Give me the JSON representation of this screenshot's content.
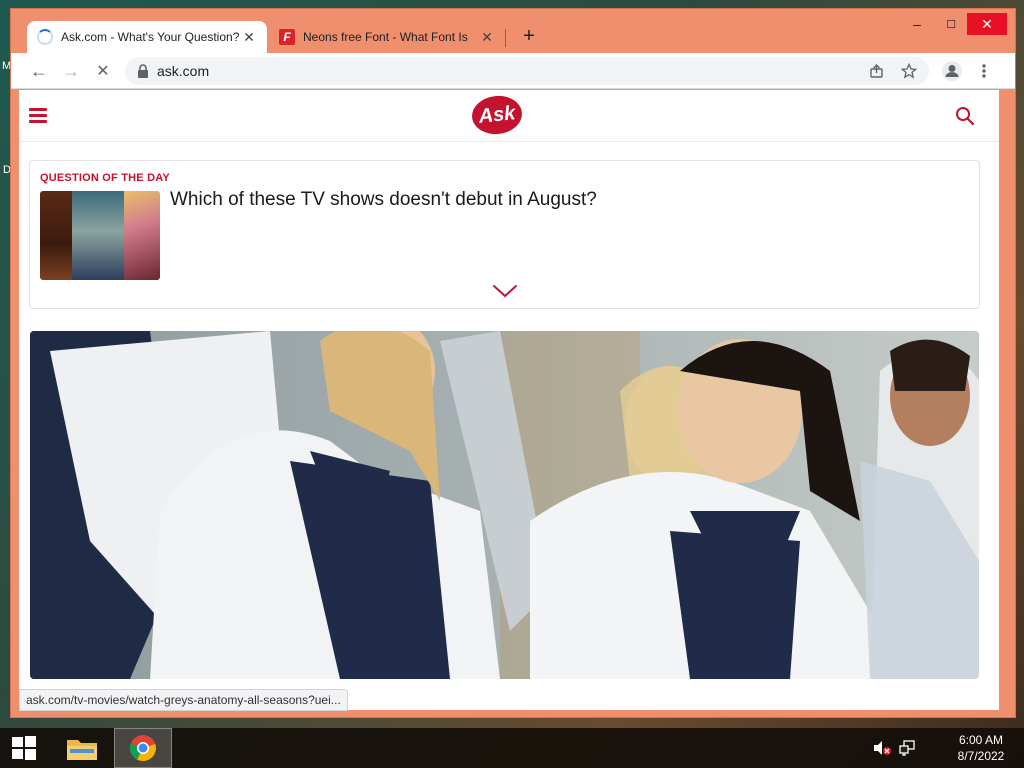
{
  "desktop": {
    "edge_text_1": "M",
    "edge_text_2": "D"
  },
  "browser": {
    "tabs": [
      {
        "title": "Ask.com - What's Your Question?",
        "close": "✕",
        "active": true
      },
      {
        "title": "Neons free Font - What Font Is",
        "close": "✕",
        "active": false,
        "favicon": "F"
      }
    ],
    "new_tab": "+",
    "window_controls": {
      "minimize": "–",
      "maximize": "☐",
      "close": "✕"
    },
    "nav": {
      "back": "←",
      "forward": "→",
      "stop": "✕"
    },
    "url": "ask.com",
    "status_url": "ask.com/tv-movies/watch-greys-anatomy-all-seasons?uei..."
  },
  "page": {
    "brand": "Ask",
    "question_of_day": {
      "label": "QUESTION OF THE DAY",
      "question": "Which of these TV shows doesn't debut in August?"
    }
  },
  "taskbar": {
    "time": "6:00 AM",
    "date": "8/7/2022"
  },
  "colors": {
    "ask_red": "#c4122f",
    "window_frame": "#f08f6d"
  }
}
